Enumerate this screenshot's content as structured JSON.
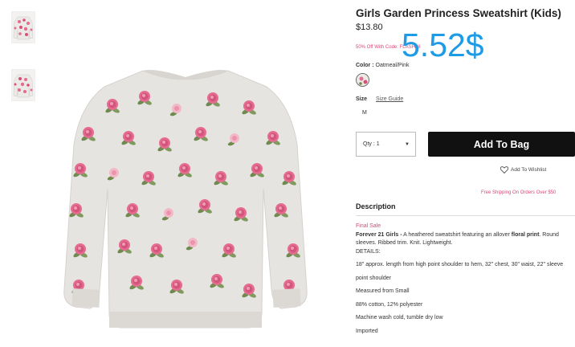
{
  "product": {
    "title": "Girls Garden Princess Sweatshirt (Kids)",
    "price": "$13.80",
    "promo": "50% Off With Code: FLASH48",
    "overlay_price": "5.52$",
    "color_label": "Color :",
    "color_value": "Oatmeal/Pink",
    "size_label": "Size",
    "size_guide": "Size Guide",
    "size_option": "M",
    "qty_label": "Qty : 1",
    "add_to_bag": "Add To Bag",
    "wishlist": "Add To Wishlist",
    "free_shipping": "Free Shipping On Orders Over $50"
  },
  "description": {
    "heading": "Description",
    "final_sale": "Final Sale",
    "brand": "Forever 21 Girls -",
    "text_a": " A heathered sweatshirt featuring an allover ",
    "text_bold": "floral print",
    "text_b": ". Round",
    "line2": "sleeves. Ribbed trim. Knit. Lightweight.",
    "details": "DETAILS:",
    "measure1": "18\" approx. length from high point shoulder to hem, 32\" chest, 30\" waist, 22\" sleeve",
    "measure2": "point shoulder",
    "measured_from": "Measured from Small",
    "fabric": "88% cotton, 12% polyester",
    "care": "Machine wash cold, tumble dry low",
    "imported": "Imported"
  },
  "colors": {
    "accent_pink": "#e0457b",
    "overlay_blue": "#1e9be6",
    "button_bg": "#111111",
    "fabric": "#e6e4e1",
    "rose": "#e56c90",
    "leaf": "#6e8a4e"
  },
  "icons": {
    "heart": "heart-icon",
    "caret": "caret-down-icon"
  }
}
